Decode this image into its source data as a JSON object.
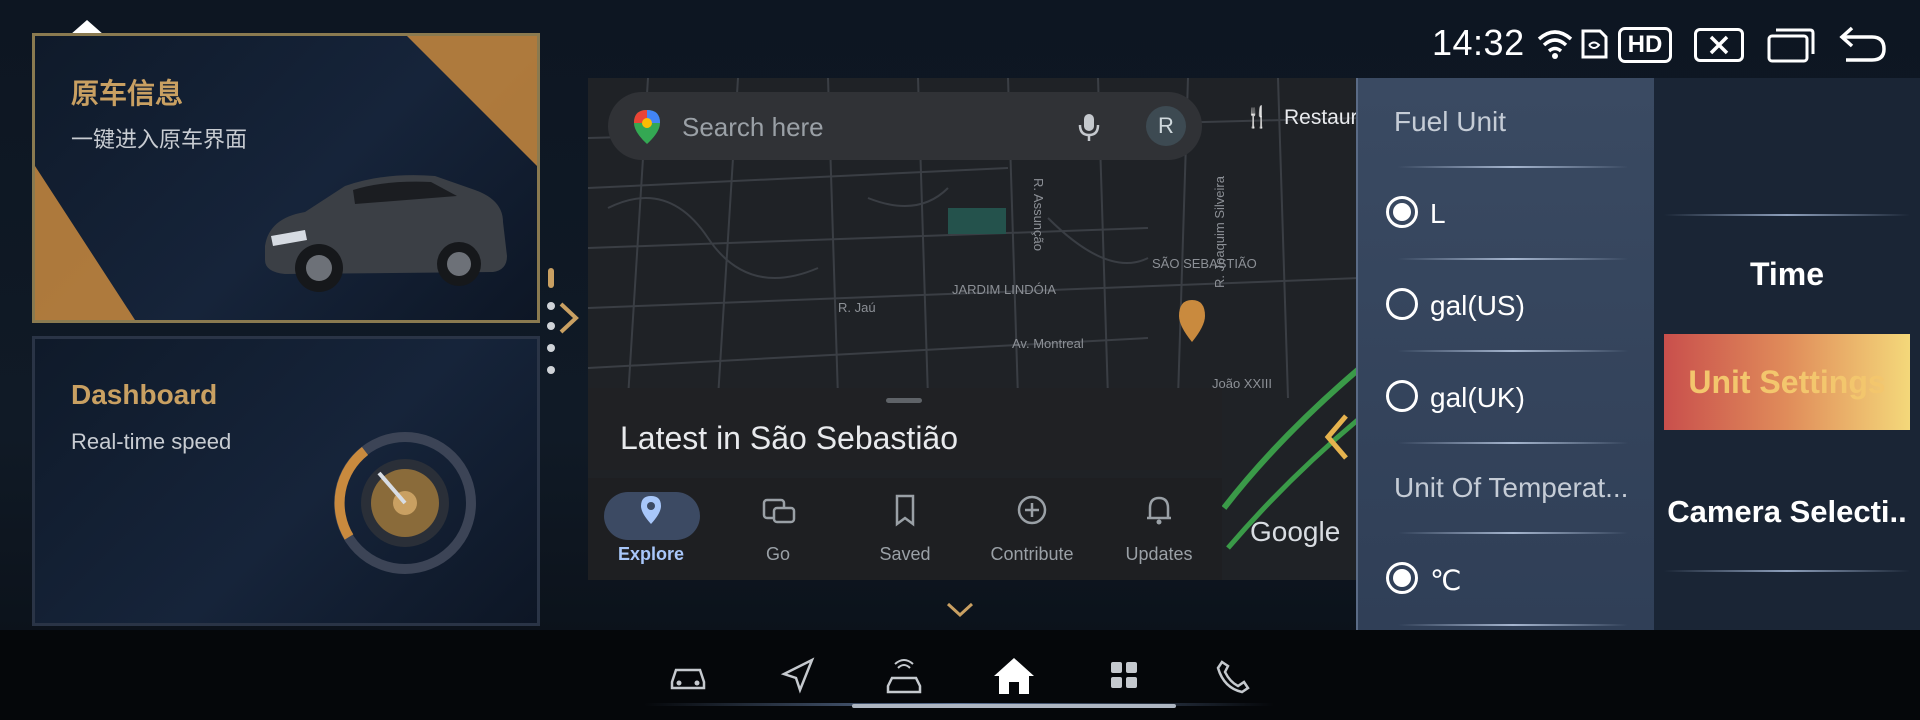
{
  "status": {
    "time": "14:32",
    "hd_label": "HD"
  },
  "cards": {
    "vehicle": {
      "title": "原车信息",
      "subtitle": "一键进入原车界面"
    },
    "dashboard": {
      "title": "Dashboard",
      "subtitle": "Real-time speed"
    }
  },
  "map": {
    "search_placeholder": "Search here",
    "avatar_letter": "R",
    "chip_restaurants": "Restaurants",
    "latest_title": "Latest in São Sebastião",
    "attribution": "Google",
    "street_labels": [
      "SÃO SEBASTIÃO",
      "JARDIM LINDÓIA",
      "Av. Montreal",
      "R. Jaú",
      "R. Assunção",
      "R. Joaquim Silveira",
      "João XXIII"
    ],
    "nav": [
      {
        "label": "Explore",
        "icon": "pin-icon",
        "active": true
      },
      {
        "label": "Go",
        "icon": "commute-icon",
        "active": false
      },
      {
        "label": "Saved",
        "icon": "bookmark-icon",
        "active": false
      },
      {
        "label": "Contribute",
        "icon": "add-circle-icon",
        "active": false
      },
      {
        "label": "Updates",
        "icon": "bell-icon",
        "active": false
      }
    ]
  },
  "popup": {
    "fuel_unit_title": "Fuel Unit",
    "fuel_options": [
      {
        "label": "L",
        "selected": true
      },
      {
        "label": "gal(US)",
        "selected": false
      },
      {
        "label": "gal(UK)",
        "selected": false
      }
    ],
    "temp_title": "Unit Of Temperat...",
    "temp_options": [
      {
        "label": "℃",
        "selected": true
      },
      {
        "label": "℉",
        "selected": false
      }
    ]
  },
  "menu": {
    "items": [
      {
        "label": "Time",
        "active": false
      },
      {
        "label": "Unit Settings",
        "active": true
      },
      {
        "label": "Camera Selecti..",
        "active": false
      }
    ]
  },
  "dock": {
    "icons": [
      "car-icon",
      "navigation-icon",
      "car-signal-icon",
      "home-icon",
      "apps-grid-icon",
      "phone-icon"
    ]
  },
  "colors": {
    "accent_gold": "#c9a062",
    "active_gradient_start": "#c94f4c",
    "active_gradient_end": "#f4d87a",
    "explore_blue": "#a8c7fa"
  }
}
